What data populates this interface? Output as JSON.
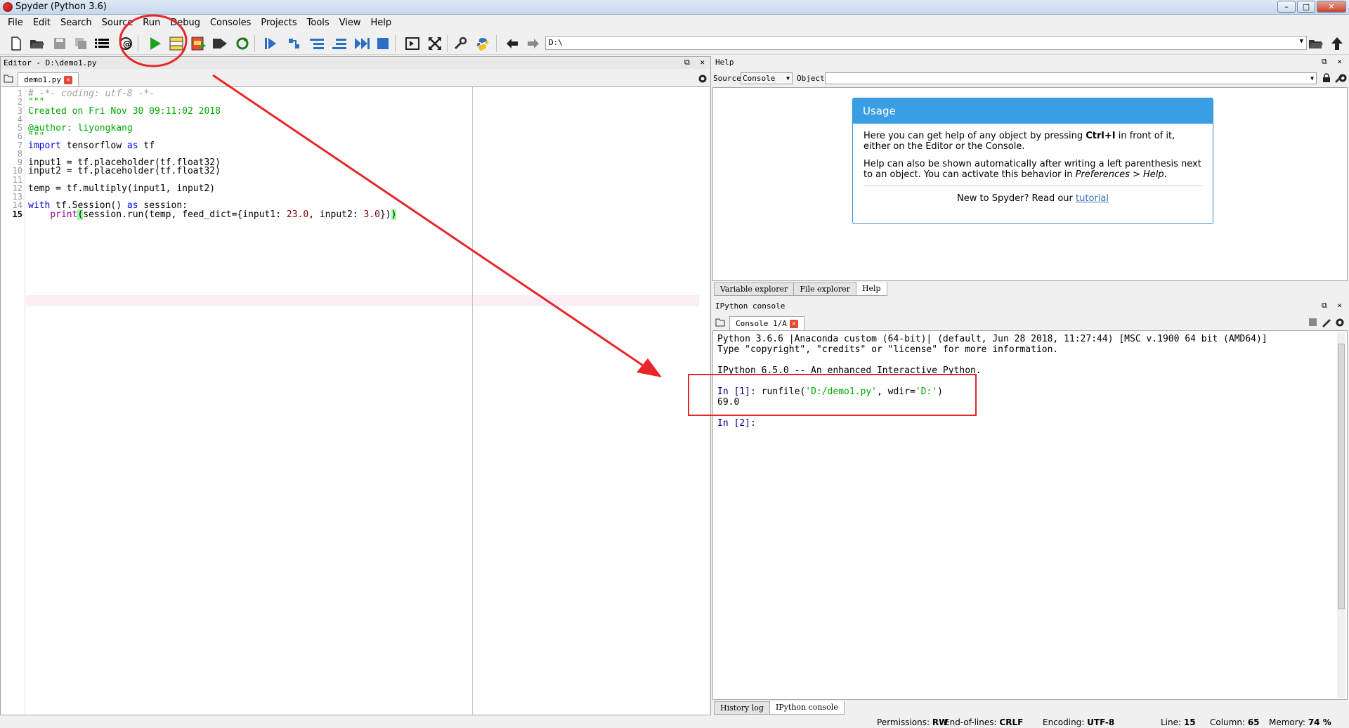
{
  "window": {
    "title": "Spyder (Python 3.6)",
    "controls": [
      "minimize",
      "maximize",
      "close"
    ]
  },
  "menu": [
    "File",
    "Edit",
    "Search",
    "Source",
    "Run",
    "Debug",
    "Consoles",
    "Projects",
    "Tools",
    "View",
    "Help"
  ],
  "toolbar": {
    "buttons": [
      "new-file",
      "open-file",
      "save-file",
      "save-all",
      "outline",
      "help",
      "run",
      "run-cell",
      "run-cell-advance",
      "run-selection",
      "rerun",
      "debug",
      "step",
      "step-into",
      "step-return",
      "continue",
      "stop",
      "maximize-pane",
      "fullscreen",
      "preferences",
      "python-path",
      "back",
      "forward",
      "browse",
      "parent-dir"
    ],
    "path": "D:\\"
  },
  "editor": {
    "header": "Editor - D:\\demo1.py",
    "tab": "demo1.py",
    "current_line": 15,
    "lines": [
      {
        "n": "1",
        "text": "# -*- coding: utf-8 -*-"
      },
      {
        "n": "2",
        "text": "\"\"\""
      },
      {
        "n": "3",
        "text": "Created on Fri Nov 30 09:11:02 2018"
      },
      {
        "n": "4",
        "text": ""
      },
      {
        "n": "5",
        "text": "@author: liyongkang"
      },
      {
        "n": "6",
        "text": "\"\"\""
      },
      {
        "n": "7",
        "text": "import tensorflow as tf"
      },
      {
        "n": "8",
        "text": ""
      },
      {
        "n": "9",
        "text": "input1 = tf.placeholder(tf.float32)"
      },
      {
        "n": "10",
        "text": "input2 = tf.placeholder(tf.float32)"
      },
      {
        "n": "11",
        "text": ""
      },
      {
        "n": "12",
        "text": "temp = tf.multiply(input1, input2)"
      },
      {
        "n": "13",
        "text": ""
      },
      {
        "n": "14",
        "text": "with tf.Session() as session:"
      },
      {
        "n": "15",
        "text": "    print(session.run(temp, feed_dict={input1: 23.0, input2: 3.0}))"
      }
    ]
  },
  "help": {
    "header": "Help",
    "source_label": "Source",
    "source_value": "Console",
    "object_label": "Object",
    "usage_title": "Usage",
    "para1_a": "Here you can get help of any object by pressing ",
    "para1_b": "Ctrl+I",
    "para1_c": " in front of it, either on the Editor or the Console.",
    "para2_a": "Help can also be shown automatically after writing a left parenthesis next to an object. You can activate this behavior in ",
    "para2_b": "Preferences > Help",
    "para2_c": ".",
    "footer_text": "New to Spyder? Read our ",
    "footer_link": "tutorial",
    "tabs": [
      "Variable explorer",
      "File explorer",
      "Help"
    ]
  },
  "console": {
    "header": "IPython console",
    "tab": "Console 1/A",
    "banner1": "Python 3.6.6 |Anaconda custom (64-bit)| (default, Jun 28 2018, 11:27:44) [MSC v.1900 64 bit (AMD64)]",
    "banner2": "Type \"copyright\", \"credits\" or \"license\" for more information.",
    "banner3": "IPython 6.5.0 -- An enhanced Interactive Python.",
    "prompt1": "In [1]:",
    "cmd_a": " runfile(",
    "cmd_arg1": "'D:/demo1.py'",
    "cmd_b": ", wdir=",
    "cmd_arg2": "'D:'",
    "cmd_c": ")",
    "output": "69.0",
    "prompt2": "In [2]:",
    "tabs": [
      "History log",
      "IPython console"
    ]
  },
  "status": {
    "permissions_label": "Permissions:",
    "permissions": "RW",
    "eol_label": "End-of-lines:",
    "eol": "CRLF",
    "encoding_label": "Encoding:",
    "encoding": "UTF-8",
    "line_label": "Line:",
    "line": "15",
    "column_label": "Column:",
    "column": "65",
    "memory_label": "Memory:",
    "memory": "74 %"
  },
  "colors": {
    "annotation": "#e8262a",
    "run_green": "#1ea01e",
    "usage_blue": "#3a9ee4",
    "string_green": "#00aa00",
    "keyword_blue": "#0000ff"
  }
}
